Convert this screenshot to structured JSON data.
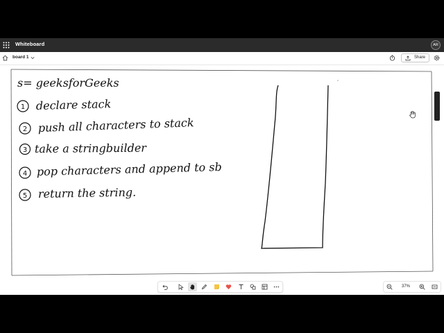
{
  "app": {
    "title": "Whiteboard",
    "user_initials": "AR"
  },
  "toolbar": {
    "board_name": "board 1",
    "share_label": "Share"
  },
  "board": {
    "lines": [
      "s= geeksforGeeks",
      "declare  stack",
      "push all characters to stack",
      "take  a  stringbuilder",
      "pop  characters  and  append  to sb",
      "return  the  string."
    ],
    "step_numbers": [
      "1",
      "2",
      "3",
      "4",
      "5"
    ]
  },
  "status": {
    "zoom": "37%"
  },
  "icons": {
    "apps": "grid-icon",
    "home": "home-icon",
    "board_menu": "chevron-down-icon",
    "timer": "timer-icon",
    "share": "share-icon",
    "settings": "gear-icon",
    "pan": "hand-icon",
    "undo": "undo-icon",
    "select": "pointer-icon",
    "hand_tool": "hand-tool-icon",
    "pen": "pen-icon",
    "note": "sticky-note-icon",
    "reaction": "heart-icon",
    "text": "text-icon",
    "shapes": "shapes-icon",
    "template": "template-icon",
    "more": "more-icon",
    "zoom_out": "zoom-out-icon",
    "zoom_in": "zoom-in-icon",
    "fit": "fit-screen-icon"
  },
  "colors": {
    "titlebar": "#2b2b2b",
    "ink": "#111111",
    "note": "#f5c542",
    "heart": "#e8534a"
  }
}
